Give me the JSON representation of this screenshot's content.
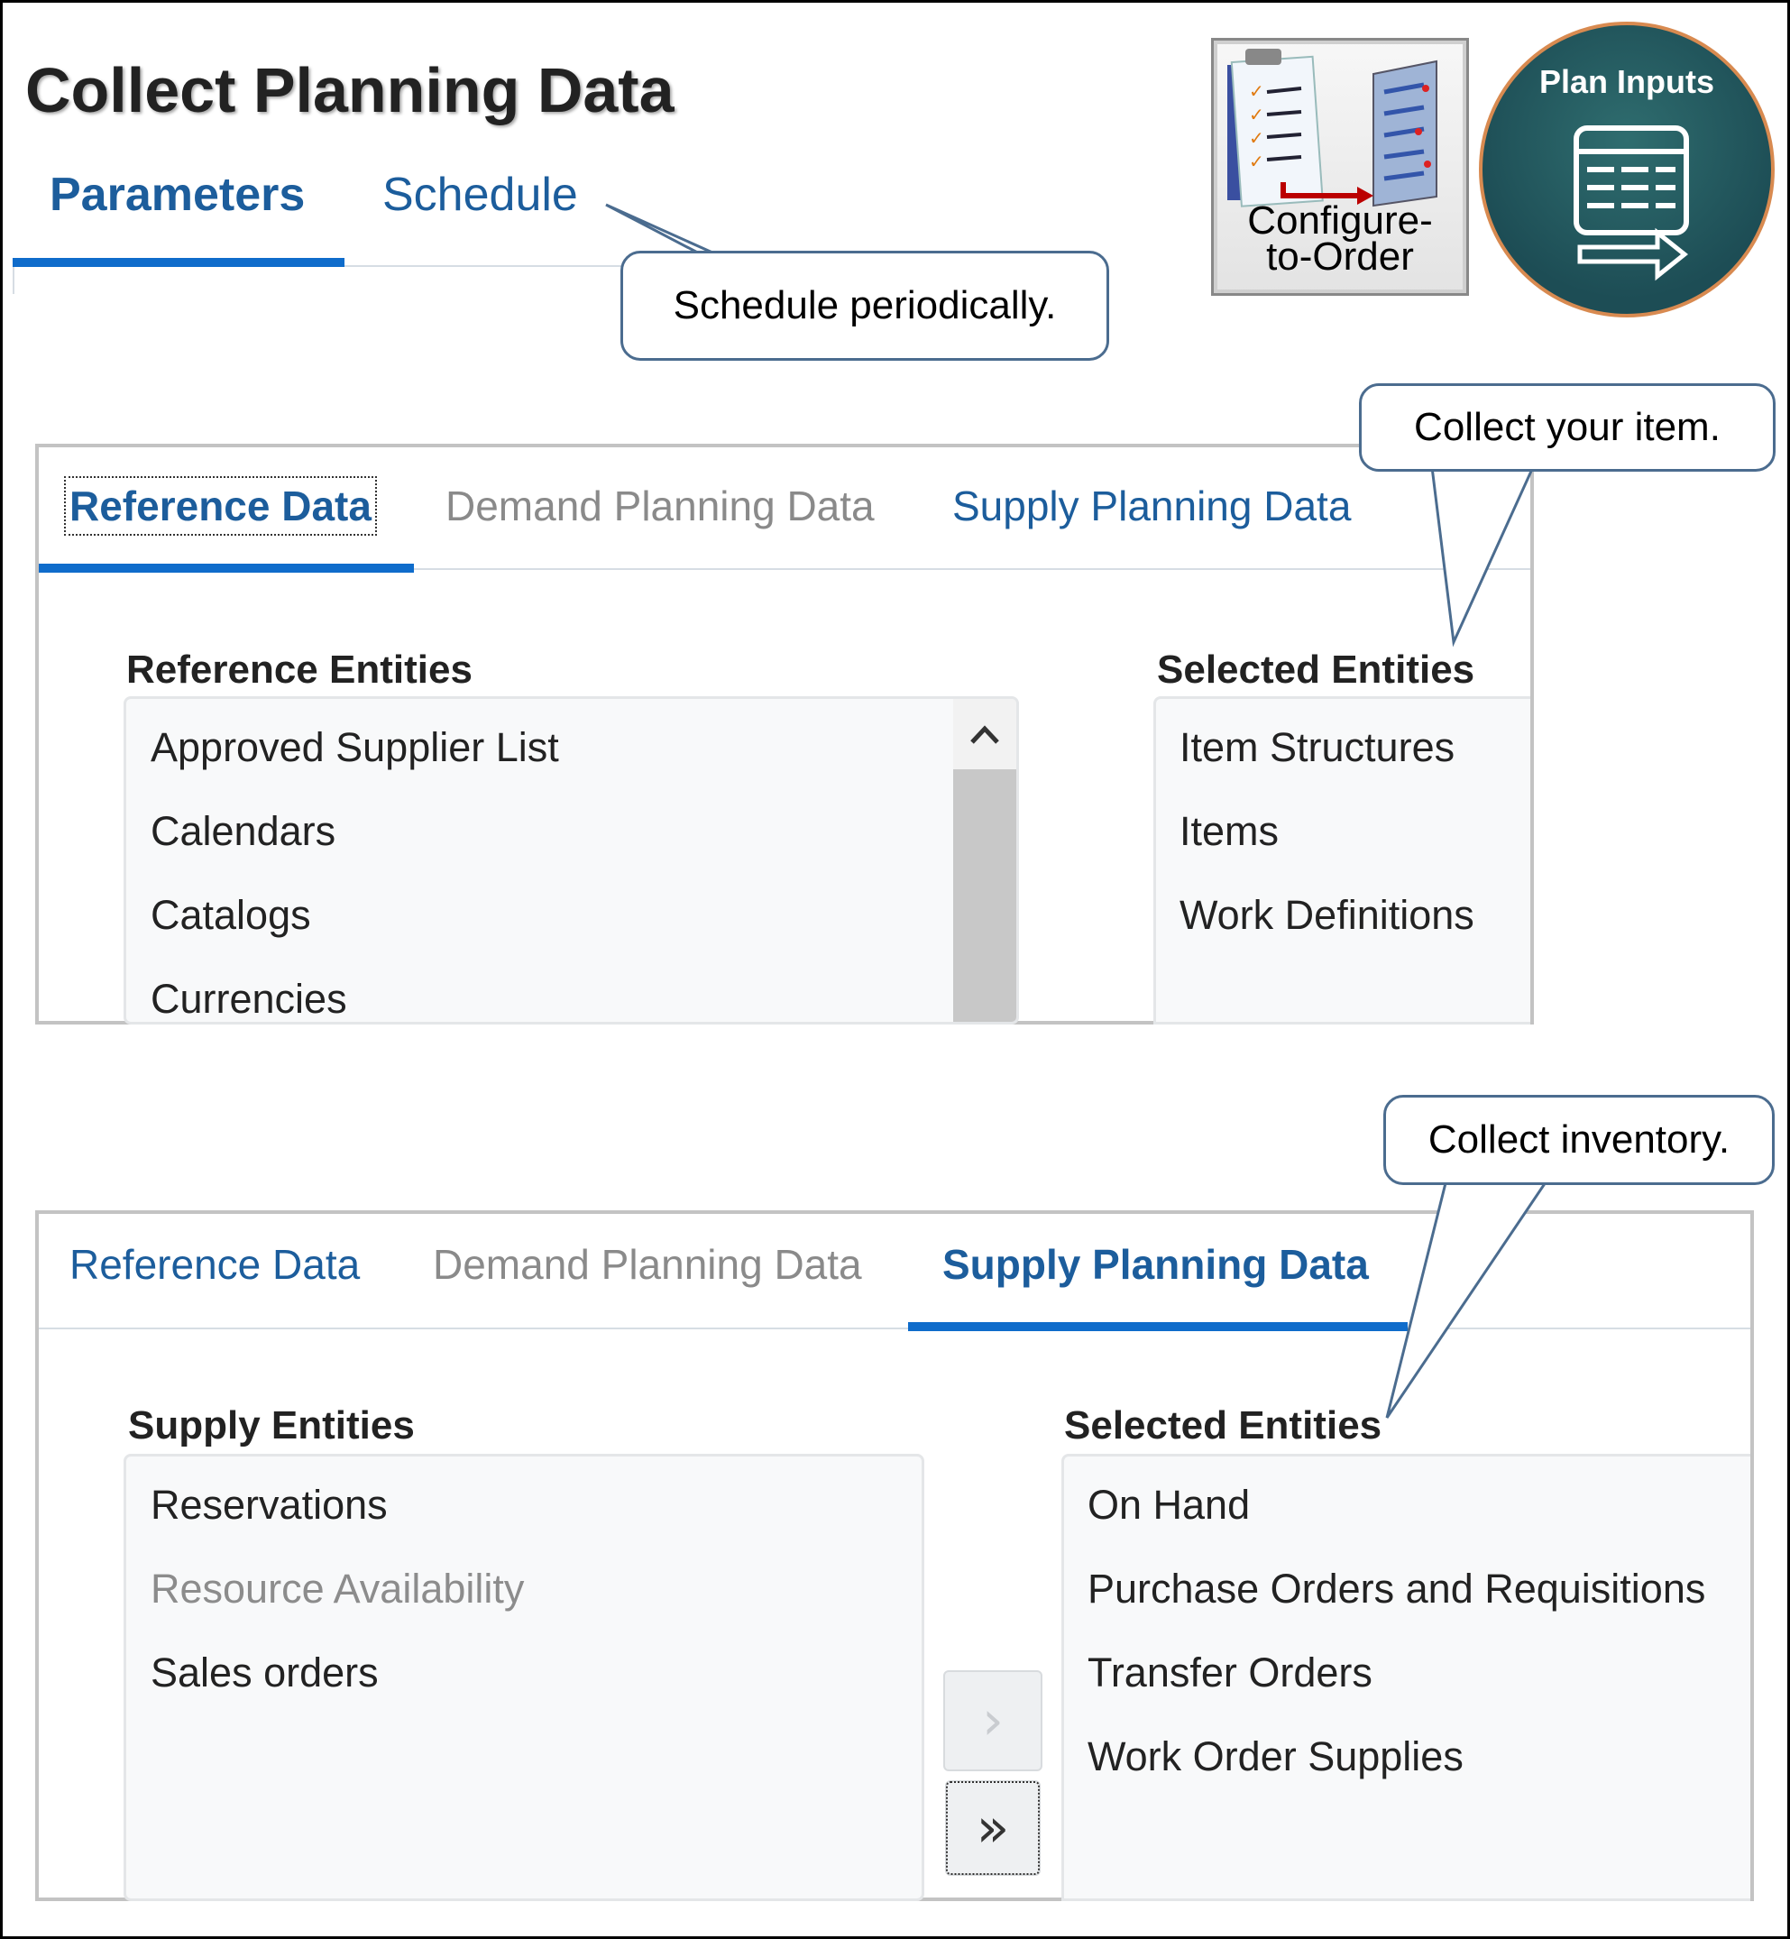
{
  "page": {
    "title": "Collect Planning Data",
    "tabs": [
      "Parameters",
      "Schedule"
    ],
    "active_tab": "Parameters"
  },
  "callouts": {
    "schedule": "Schedule periodically.",
    "item": "Collect your item.",
    "inventory": "Collect inventory."
  },
  "badges": {
    "cto": [
      "Configure-",
      "to-Order"
    ],
    "plan_inputs": "Plan Inputs"
  },
  "panel1": {
    "tabs": [
      "Reference Data",
      "Demand Planning Data",
      "Supply Planning Data"
    ],
    "active_tab": "Reference Data",
    "available_heading": "Reference Entities",
    "available": [
      "Approved Supplier List",
      "Calendars",
      "Catalogs",
      "Currencies"
    ],
    "selected_heading": "Selected Entities",
    "selected": [
      "Item Structures",
      "Items",
      "Work Definitions"
    ]
  },
  "panel2": {
    "tabs": [
      "Reference Data",
      "Demand Planning Data",
      "Supply Planning Data"
    ],
    "active_tab": "Supply Planning Data",
    "available_heading": "Supply Entities",
    "available": [
      "Reservations",
      "Resource Availability",
      "Sales orders"
    ],
    "available_disabled": [
      "Resource Availability"
    ],
    "selected_heading": "Selected Entities",
    "selected": [
      "On Hand",
      "Purchase Orders and Requisitions",
      "Transfer Orders",
      "Work Order Supplies"
    ],
    "buttons": {
      "move_selected": "›",
      "move_all": "»"
    }
  },
  "colors": {
    "link_blue": "#1c5d9c",
    "active_underline": "#0f6ccb",
    "callout_border": "#4b6c8f",
    "badge_teal": "#1d4d55",
    "badge_ring": "#d88a50"
  }
}
